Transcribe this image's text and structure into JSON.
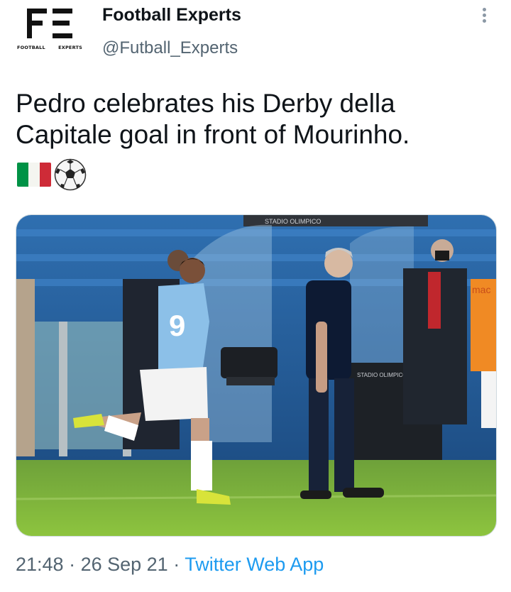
{
  "author": {
    "display_name": "Football Experts",
    "handle": "@Futball_Experts",
    "avatar_caption_left": "FOOTBALL",
    "avatar_caption_right": "EXPERTS"
  },
  "tweet": {
    "text": "Pedro celebrates his Derby della Capitale goal in front of Mourinho.",
    "emojis": [
      "italy-flag-emoji",
      "soccer-ball-emoji"
    ]
  },
  "photo": {
    "banner_text": "STADIO OLIMPICO",
    "dugout_sign": "STADIO OLIMPICO",
    "shirt_number": "9",
    "side_shirt_text": "mac"
  },
  "meta": {
    "time": "21:48",
    "separator1": " · ",
    "date": "26 Sep 21",
    "separator2": " · ",
    "app": "Twitter Web App"
  },
  "colors": {
    "handle": "#536471",
    "link": "#1d9bf0",
    "lazio_blue": "#87bde8"
  }
}
